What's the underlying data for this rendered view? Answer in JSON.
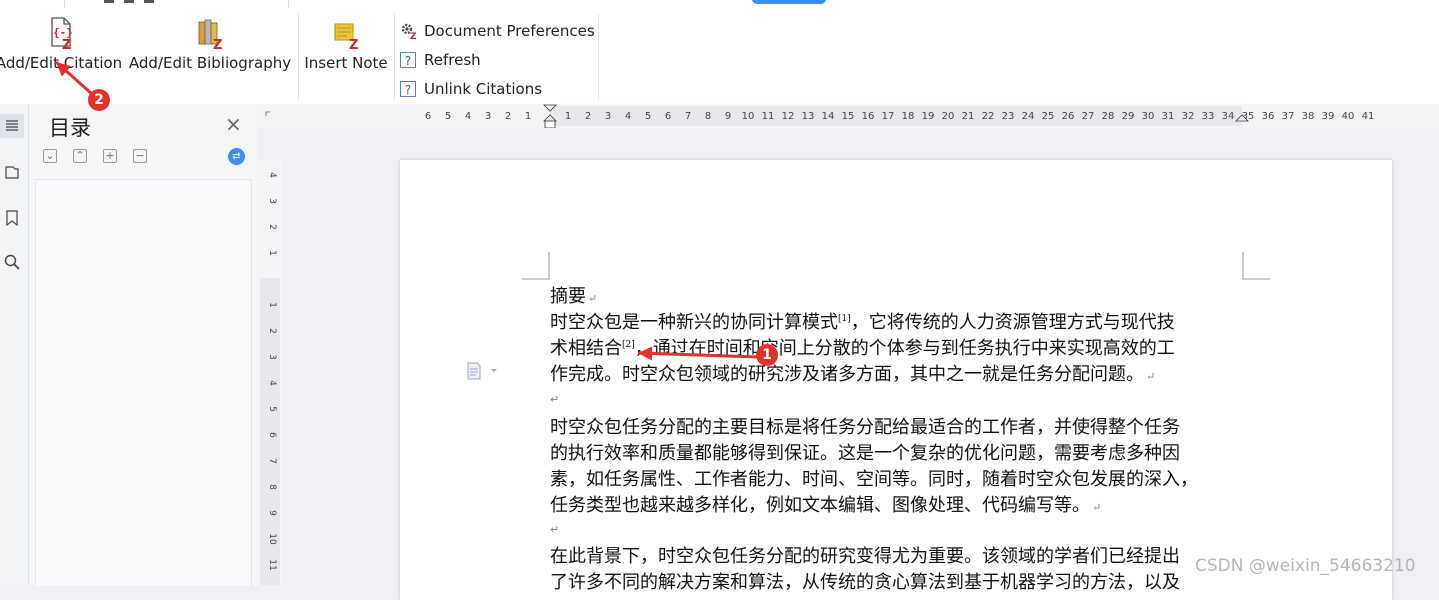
{
  "ribbon": {
    "add_edit_citation": "Add/Edit Citation",
    "add_edit_bibliography": "Add/Edit Bibliography",
    "insert_note": "Insert Note",
    "document_preferences": "Document Preferences",
    "refresh": "Refresh",
    "unlink_citations": "Unlink Citations"
  },
  "toc": {
    "title": "目录",
    "close": "×"
  },
  "ruler": {
    "h_ticks": [
      "6",
      "5",
      "4",
      "3",
      "2",
      "1",
      "",
      "1",
      "2",
      "3",
      "4",
      "5",
      "6",
      "7",
      "8",
      "9",
      "10",
      "11",
      "12",
      "13",
      "14",
      "15",
      "16",
      "17",
      "18",
      "19",
      "20",
      "21",
      "22",
      "23",
      "24",
      "25",
      "26",
      "27",
      "28",
      "29",
      "30",
      "31",
      "32",
      "33",
      "34",
      "35",
      "36",
      "37",
      "38",
      "39",
      "40",
      "41"
    ],
    "v_ticks_top": [
      "4",
      "3",
      "2",
      "1"
    ],
    "v_ticks_bottom": [
      "1",
      "2",
      "3",
      "4",
      "5",
      "6",
      "7",
      "8",
      "9",
      "10",
      "11"
    ]
  },
  "document": {
    "heading": "摘要",
    "p1_l1_a": "时空众包是一种新兴的协同计算模式",
    "cite1": "[1]",
    "p1_l1_b": "，它将传统的人力资源管理方式与现代技",
    "p1_l2_a": "术相结合",
    "cite2": "[2]",
    "p1_l2_b": "，通过在时间和空间上分散的个体参与到任务执行中来实现高效的工",
    "p1_l3": "作完成。时空众包领域的研究涉及诸多方面，其中之一就是任务分配问题。",
    "p2_l1": "时空众包任务分配的主要目标是将任务分配给最适合的工作者，并使得整个任务",
    "p2_l2": "的执行效率和质量都能够得到保证。这是一个复杂的优化问题，需要考虑多种因",
    "p2_l3": "素，如任务属性、工作者能力、时间、空间等。同时，随着时空众包发展的深入，",
    "p2_l4": "任务类型也越来越多样化，例如文本编辑、图像处理、代码编写等。",
    "p3_l1": "在此背景下，时空众包任务分配的研究变得尤为重要。该领域的学者们已经提出",
    "p3_l2": "了许多不同的解决方案和算法，从传统的贪心算法到基于机器学习的方法，以及"
  },
  "annotations": {
    "badge1": "1",
    "badge2": "2",
    "arrow_color": "#e5312c"
  },
  "watermark": "CSDN @weixin_54663210",
  "colors": {
    "accent": "#3d8ef0",
    "endnote_red": "#c8281e"
  }
}
